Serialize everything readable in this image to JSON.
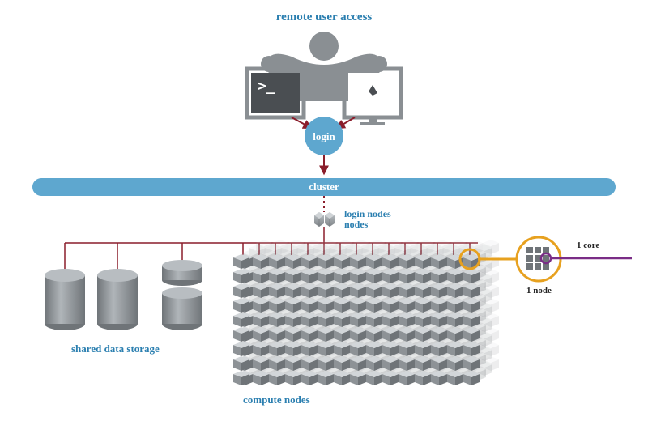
{
  "title": "remote user access",
  "login_label": "login",
  "cluster_label": "cluster",
  "login_nodes_label": "login\nnodes",
  "storage_label": "shared data storage",
  "compute_label": "compute nodes",
  "one_core_label": "1 core",
  "one_node_label": "1 node",
  "colors": {
    "blue": "#5ea7cf",
    "blue_text": "#2b7fb0",
    "red": "#8a1d2b",
    "gray": "#8a8f93",
    "gray_dark": "#6f7478",
    "orange": "#e7a11f",
    "purple": "#7a2d86"
  },
  "compute_grid": {
    "rows": 9,
    "cols": 15
  }
}
